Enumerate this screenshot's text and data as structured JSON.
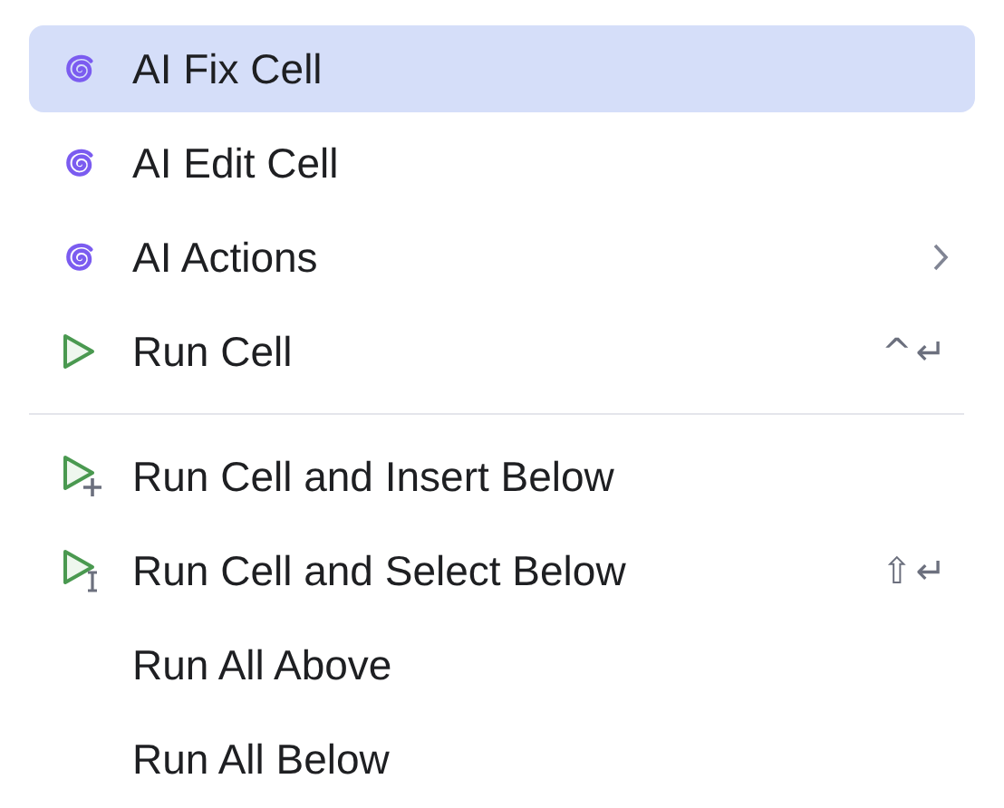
{
  "menu": {
    "groups": [
      {
        "items": [
          {
            "label": "AI Fix Cell",
            "kind": "ai",
            "selected": true
          },
          {
            "label": "AI Edit Cell",
            "kind": "ai",
            "selected": false
          },
          {
            "label": "AI Actions",
            "kind": "ai",
            "selected": false,
            "submenu": true
          },
          {
            "label": "Run Cell",
            "kind": "run",
            "selected": false,
            "shortcut": "^↵"
          }
        ]
      },
      {
        "items": [
          {
            "label": "Run Cell and Insert Below",
            "kind": "run-insert",
            "selected": false
          },
          {
            "label": "Run Cell and Select Below",
            "kind": "run-select",
            "selected": false,
            "shortcut": "⇧↵"
          },
          {
            "label": "Run All Above",
            "kind": "plain",
            "selected": false
          },
          {
            "label": "Run All Below",
            "kind": "plain",
            "selected": false
          }
        ]
      }
    ]
  }
}
